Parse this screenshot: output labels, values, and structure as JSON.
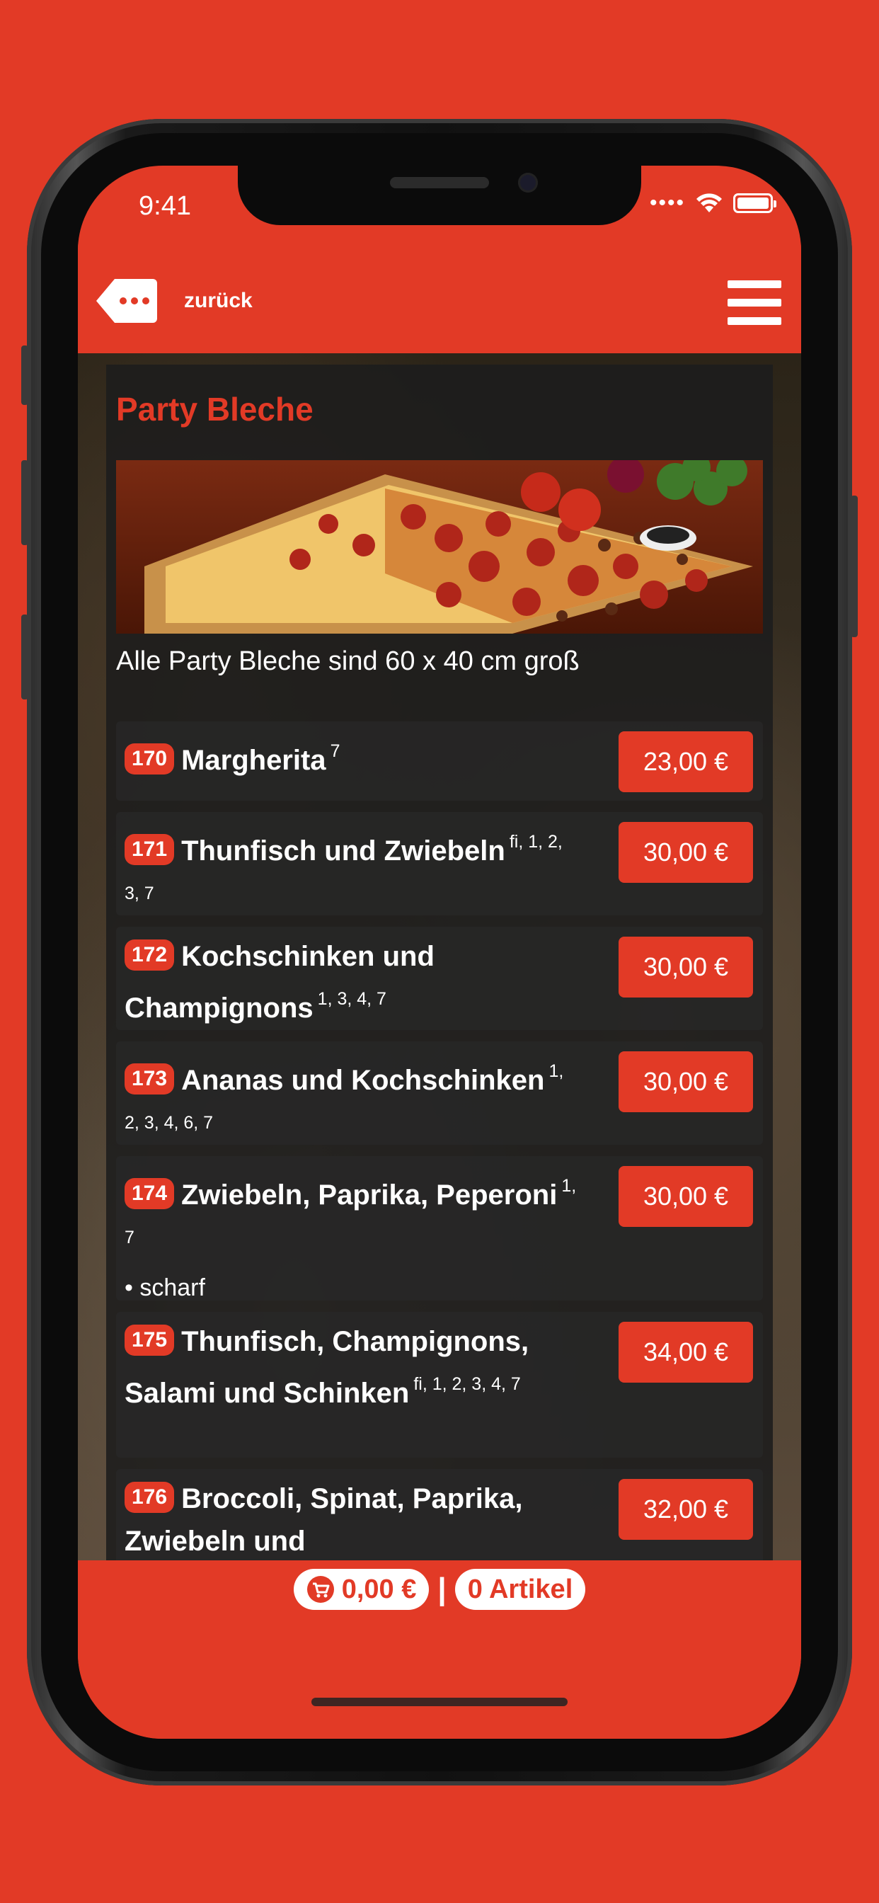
{
  "status_bar": {
    "time": "9:41"
  },
  "app_bar": {
    "back_label": "zurück"
  },
  "category": {
    "title": "Party Bleche",
    "description": "Alle Party Bleche sind 60 x 40 cm groß"
  },
  "items": [
    {
      "number": "170",
      "name": "Margherita",
      "allergens": "7",
      "note": "",
      "price": "23,00 €"
    },
    {
      "number": "171",
      "name": "Thunfisch und Zwiebeln",
      "allergens": "fi, 1, 2, 3, 7",
      "note": "",
      "price": "30,00 €"
    },
    {
      "number": "172",
      "name": "Kochschinken und Champignons",
      "allergens": "1, 3, 4, 7",
      "note": "",
      "price": "30,00 €"
    },
    {
      "number": "173",
      "name": "Ananas und Kochschinken",
      "allergens": "1, 2, 3, 4, 6, 7",
      "note": "",
      "price": "30,00 €"
    },
    {
      "number": "174",
      "name": "Zwiebeln, Paprika, Peperoni",
      "allergens": "1, 7",
      "note": "• scharf",
      "price": "30,00 €"
    },
    {
      "number": "175",
      "name": "Thunfisch, Champignons, Salami und Schinken",
      "allergens": "fi, 1, 2, 3, 4, 7",
      "note": "",
      "price": "34,00 €"
    },
    {
      "number": "176",
      "name": "Broccoli, Spinat, Paprika, Zwiebeln und",
      "allergens": "",
      "note": "",
      "price": "32,00 €"
    }
  ],
  "cart": {
    "total": "0,00 €",
    "separator": "|",
    "count_label": "0 Artikel"
  },
  "colors": {
    "brand": "#e23a26"
  }
}
